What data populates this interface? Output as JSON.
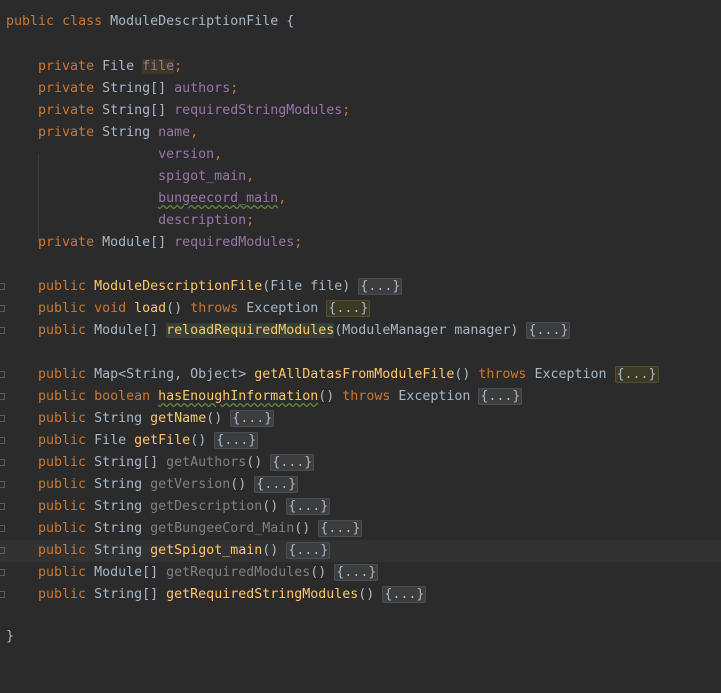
{
  "editor": {
    "class_decl": {
      "kw_public": "public",
      "kw_class": "class",
      "name": "ModuleDescriptionFile",
      "brace": " {"
    },
    "fields": {
      "f1": {
        "kw": "private",
        "type": "File",
        "name": "file",
        "end": ";"
      },
      "f2": {
        "kw": "private",
        "type": "String[]",
        "name": "authors",
        "end": ";"
      },
      "f3": {
        "kw": "private",
        "type": "String[]",
        "name": "requiredStringModules",
        "end": ";"
      },
      "f4": {
        "kw": "private",
        "type": "String",
        "name": "name",
        "end": ","
      },
      "f5": {
        "name": "version",
        "end": ","
      },
      "f6": {
        "name": "spigot_main",
        "end": ","
      },
      "f7": {
        "name": "bungeecord_main",
        "end": ","
      },
      "f8": {
        "name": "description",
        "end": ";"
      },
      "f9": {
        "kw": "private",
        "type": "Module[]",
        "name": "requiredModules",
        "end": ";"
      }
    },
    "methods": {
      "m1": {
        "kw": "public",
        "type": "",
        "name": "ModuleDescriptionFile",
        "params": "(File file) ",
        "fold": "{...}"
      },
      "m2": {
        "kw": "public",
        "kw2": "void",
        "name": "load",
        "params": "() ",
        "throws": "throws",
        "exc": " Exception ",
        "fold": "{...}"
      },
      "m3": {
        "kw": "public",
        "type": "Module[]",
        "name": "reloadRequiredModules",
        "params": "(ModuleManager manager) ",
        "fold": "{...}"
      },
      "m4": {
        "kw": "public",
        "type": "Map<String, Object>",
        "name": "getAllDatasFromModuleFile",
        "params": "() ",
        "throws": "throws",
        "exc": " Exception ",
        "fold": "{...}"
      },
      "m5": {
        "kw": "public",
        "kw2": "boolean",
        "name": "hasEnoughInformation",
        "params": "() ",
        "throws": "throws",
        "exc": " Exception ",
        "fold": "{...}"
      },
      "m6": {
        "kw": "public",
        "type": "String",
        "name": "getName",
        "params": "() ",
        "fold": "{...}"
      },
      "m7": {
        "kw": "public",
        "type": "File",
        "name": "getFile",
        "params": "() ",
        "fold": "{...}"
      },
      "m8": {
        "kw": "public",
        "type": "String[]",
        "name": "getAuthors",
        "params": "() ",
        "fold": "{...}"
      },
      "m9": {
        "kw": "public",
        "type": "String",
        "name": "getVersion",
        "params": "() ",
        "fold": "{...}"
      },
      "m10": {
        "kw": "public",
        "type": "String",
        "name": "getDescription",
        "params": "() ",
        "fold": "{...}"
      },
      "m11": {
        "kw": "public",
        "type": "String",
        "name": "getBungeeCord_Main",
        "params": "() ",
        "fold": "{...}"
      },
      "m12": {
        "kw": "public",
        "type": "String",
        "name": "getSpigot_main",
        "params": "() ",
        "fold": "{...}"
      },
      "m13": {
        "kw": "public",
        "type": "Module[]",
        "name": "getRequiredModules",
        "params": "() ",
        "fold": "{...}"
      },
      "m14": {
        "kw": "public",
        "type": "String[]",
        "name": "getRequiredStringModules",
        "params": "() ",
        "fold": "{...}"
      }
    },
    "closing_brace": "}"
  },
  "colors": {
    "background": "#2b2b2b",
    "keyword": "#cc7832",
    "field": "#9876aa",
    "method": "#ffc66d",
    "unused_method": "#808080",
    "text": "#a9b7c6",
    "current_line": "#323232"
  }
}
